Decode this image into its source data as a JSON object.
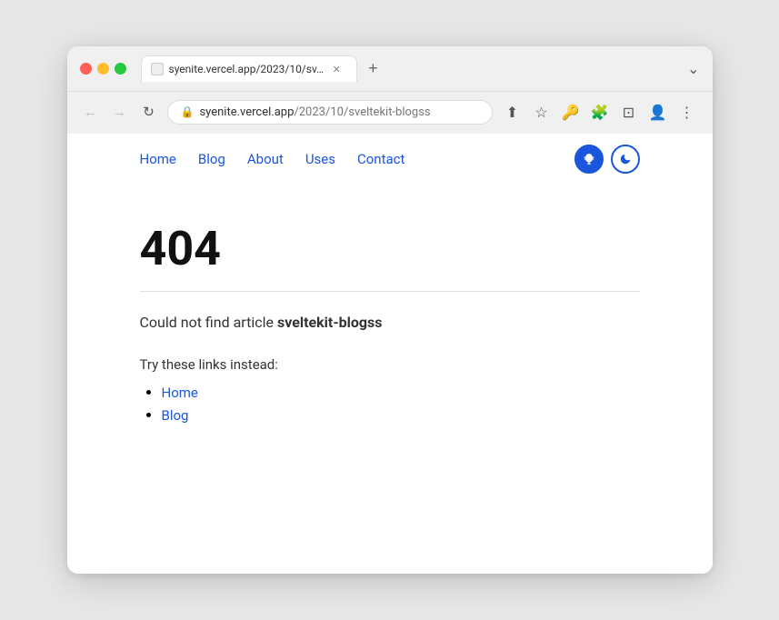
{
  "browser": {
    "url_host": "syenite.vercel.app",
    "url_path": "/2023/10/sveltekit-blogss",
    "url_display": "syenite.vercel.app/2023/10/sv…",
    "tab_label": "syenite.vercel.app/2023/10/sv…",
    "new_tab_label": "+",
    "window_controls": {
      "red": "close",
      "yellow": "minimize",
      "green": "maximize"
    },
    "more_options": "⌄"
  },
  "nav": {
    "links": [
      {
        "label": "Home",
        "href": "#"
      },
      {
        "label": "Blog",
        "href": "#"
      },
      {
        "label": "About",
        "href": "#"
      },
      {
        "label": "Uses",
        "href": "#"
      },
      {
        "label": "Contact",
        "href": "#"
      }
    ],
    "icon_trophy": "🏆",
    "icon_moon": "🌙"
  },
  "page": {
    "error_code": "404",
    "error_message_prefix": "Could not find article ",
    "error_article": "sveltekit-blogss",
    "links_label": "Try these links instead:",
    "links": [
      {
        "label": "Home",
        "href": "#"
      },
      {
        "label": "Blog",
        "href": "#"
      }
    ]
  },
  "toolbar": {
    "back": "←",
    "forward": "→",
    "reload": "↻",
    "share": "⬆",
    "bookmark": "☆",
    "password": "🔑",
    "extensions": "🧩",
    "split": "⊡",
    "profile": "👤",
    "more": "⋮",
    "lock_icon": "🔒"
  }
}
